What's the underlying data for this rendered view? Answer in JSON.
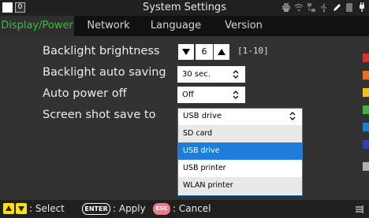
{
  "header": {
    "title": "System Settings",
    "left_badge": "0",
    "status_icons": [
      "printer-icon",
      "wifi-icon",
      "network-icon",
      "usb-icon",
      "pen-icon",
      "sd-card-icon",
      "plug-icon"
    ]
  },
  "tabs": [
    {
      "label": "Display/Power",
      "active": true
    },
    {
      "label": "Network",
      "active": false
    },
    {
      "label": "Language",
      "active": false
    },
    {
      "label": "Version",
      "active": false
    }
  ],
  "settings": {
    "backlight_brightness": {
      "label": "Backlight brightness",
      "value": "6",
      "range": "[1-10]"
    },
    "backlight_auto_saving": {
      "label": "Backlight auto saving",
      "value": "30 sec."
    },
    "auto_power_off": {
      "label": "Auto power off",
      "value": "Off"
    },
    "screenshot_save_to": {
      "label": "Screen shot save to",
      "value": "USB drive",
      "options": [
        "SD card",
        "USB drive",
        "USB printer",
        "WLAN printer"
      ],
      "selected_index": 1
    }
  },
  "color_strip": [
    "#e03030",
    "#e87020",
    "#f0c020",
    "#40b040",
    "#2080d0",
    "#3040b0",
    "#b0b0b0"
  ],
  "footer": {
    "select_label": ": Select",
    "enter_key": "ENTER",
    "apply_label": ": Apply",
    "esc_key": "ESC",
    "cancel_label": ": Cancel"
  },
  "colors": {
    "active_tab_text": "#31c631",
    "selection": "#1d7dd8",
    "key_yellow": "#ffe400",
    "esc_pink": "#f27a88"
  }
}
